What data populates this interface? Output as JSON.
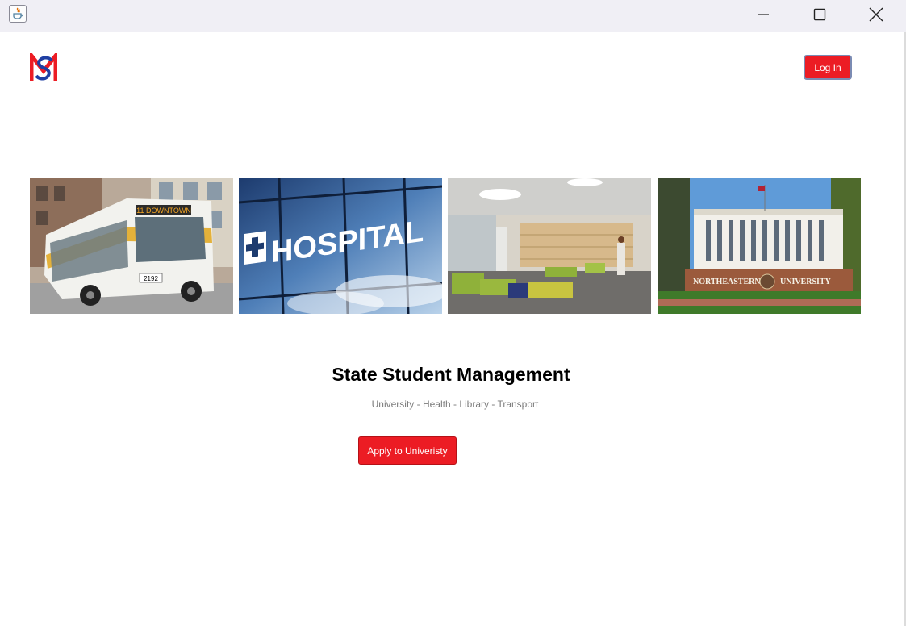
{
  "window": {
    "controls": {
      "minimize": "minimize-icon",
      "maximize": "maximize-icon",
      "close": "close-icon"
    }
  },
  "header": {
    "logo_text": "SM",
    "login_label": "Log In"
  },
  "gallery": {
    "images": [
      {
        "name": "bus-photo",
        "sign_text": "11 DOWNTOWN",
        "plate_text": "2192"
      },
      {
        "name": "hospital-photo",
        "sign_text": "HOSPITAL"
      },
      {
        "name": "library-photo"
      },
      {
        "name": "university-photo",
        "sign_text": "NORTHEASTERN",
        "sign_text_2": "UNIVERSITY"
      }
    ]
  },
  "main": {
    "title": "State Student Management",
    "subtitle": "University - Health - Library - Transport",
    "apply_label": "Apply to Univeristy"
  },
  "colors": {
    "accent": "#ec1c24",
    "logo_blue": "#1f3fa3",
    "titlebar": "#f0eff5",
    "subtitle": "#7c7c7c"
  }
}
